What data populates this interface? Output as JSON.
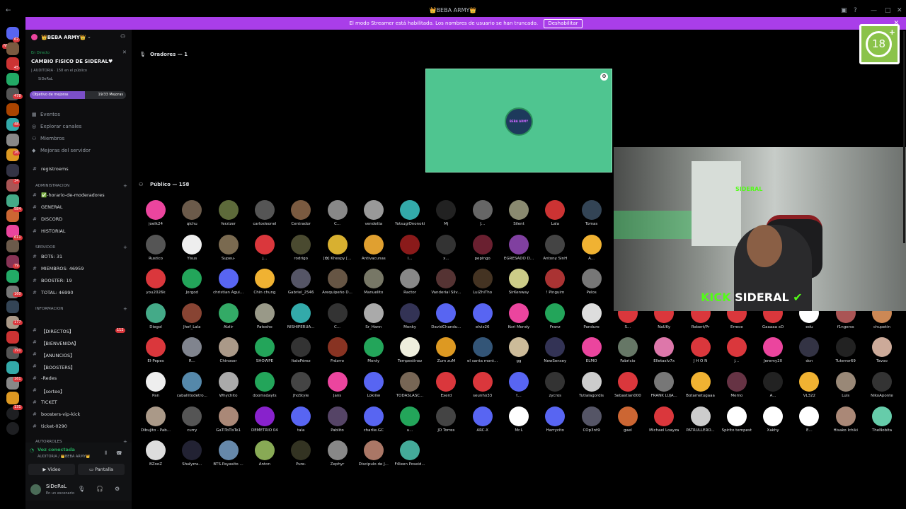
{
  "window": {
    "title": "👑BEBA ARMY👑"
  },
  "banner": {
    "text": "El modo Streamer está habilitado. Los nombres de usuario se han truncado.",
    "button": "Deshabilitar"
  },
  "guild_bar": {
    "new_badge": "NUEVO",
    "badges": [
      "62",
      "45",
      "478",
      "48",
      "26",
      "34",
      "584",
      "611",
      "79",
      "160",
      "177",
      "191",
      "161",
      "131"
    ]
  },
  "server": {
    "name": "👑BEBA ARMY👑",
    "live_tag": "En Directo",
    "stage_title": "CAMBIO FISICO DE SIDERAL♥",
    "stage_meta": "| AUDITORIA · 158 en el público",
    "host": "SiDeRaL",
    "goal_label": "Objetivo de mejoras",
    "goal_progress": "19/33 Mejoras",
    "goal_fraction": 0.576
  },
  "menu": [
    {
      "icon": "calendar-icon",
      "label": "Eventos"
    },
    {
      "icon": "compass-icon",
      "label": "Explorar canales"
    },
    {
      "icon": "members-icon",
      "label": "Miembros"
    },
    {
      "icon": "boost-icon",
      "label": "Mejoras del servidor"
    }
  ],
  "channels": [
    {
      "kind": "channel",
      "label": "registroems"
    },
    {
      "kind": "category",
      "label": "ADMINISTRACION"
    },
    {
      "kind": "channel",
      "label": "✅-horario-de-moderadores"
    },
    {
      "kind": "channel",
      "label": "GENERAL"
    },
    {
      "kind": "channel",
      "label": "DISCORD"
    },
    {
      "kind": "channel",
      "label": "HISTORIAL"
    },
    {
      "kind": "category",
      "label": "SERVIDOR"
    },
    {
      "kind": "channel",
      "label": "BOTS: 31"
    },
    {
      "kind": "channel",
      "label": "MIEMBROS: 46959"
    },
    {
      "kind": "channel",
      "label": "BOOSTER: 19"
    },
    {
      "kind": "channel",
      "label": "TOTAL: 46990"
    },
    {
      "kind": "category",
      "label": "INFORMACION"
    },
    {
      "kind": "channel",
      "label": "【DIRECTOS】",
      "badge": "112"
    },
    {
      "kind": "channel",
      "label": "【BIENVENIDA】"
    },
    {
      "kind": "channel",
      "label": "【ANUNCIOS】"
    },
    {
      "kind": "channel",
      "label": "【BOOSTERS】"
    },
    {
      "kind": "channel",
      "label": "-Redes"
    },
    {
      "kind": "channel",
      "label": "【sorteo】"
    },
    {
      "kind": "channel",
      "label": "TICKET"
    },
    {
      "kind": "channel",
      "label": "boosters-vip-kick"
    },
    {
      "kind": "channel",
      "label": "ticket-0290"
    },
    {
      "kind": "category",
      "label": "AUTORROLES"
    }
  ],
  "voice": {
    "status": "Voz conectada",
    "location": "AUDITORIA / 👑BEBA ARMY👑",
    "video_label": "Video",
    "screen_label": "Pantalla"
  },
  "user": {
    "name": "SiDeRaL",
    "status": "En un escenario"
  },
  "stage": {
    "speakers_header": "Oradores — 1",
    "speaker_avatar_text": "BEBA ARMY",
    "public_header": "Público — 158"
  },
  "audience": [
    {
      "name": "joelk24",
      "color": "#eb459e"
    },
    {
      "name": "qichu",
      "color": "#6b5a4a"
    },
    {
      "name": "ferzizer",
      "color": "#5d6a3a"
    },
    {
      "name": "carlosleonel",
      "color": "#555"
    },
    {
      "name": "Centrador",
      "color": "#7a5a40"
    },
    {
      "name": "C...",
      "color": "#888"
    },
    {
      "name": "vendetta",
      "color": "#999"
    },
    {
      "name": "YotsugiOnonoki",
      "color": "#3aa"
    },
    {
      "name": "Mj",
      "color": "#222"
    },
    {
      "name": "J...",
      "color": "#666"
    },
    {
      "name": "Silent",
      "color": "#8a8a70"
    },
    {
      "name": "Lala",
      "color": "#c33"
    },
    {
      "name": "Tomas",
      "color": "#345"
    },
    {
      "name": "Rustico",
      "color": "#555"
    },
    {
      "name": "Yisus",
      "color": "#eee"
    },
    {
      "name": "Supeu-",
      "color": "#7a6a50"
    },
    {
      "name": "j...",
      "color": "#da373c"
    },
    {
      "name": "rodrigo",
      "color": "#4a4a30"
    },
    {
      "name": "[✿] Khespy [...",
      "color": "#d8b030"
    },
    {
      "name": "Antivacunas",
      "color": "#e0a030"
    },
    {
      "name": "l...",
      "color": "#8a1a1a"
    },
    {
      "name": "x...",
      "color": "#333"
    },
    {
      "name": "pepingo",
      "color": "#6a2030"
    },
    {
      "name": "EGRESADO D...",
      "color": "#8040a0"
    },
    {
      "name": "Antony SinH",
      "color": "#444"
    },
    {
      "name": "A...",
      "color": "#f0b232"
    },
    {
      "name": "you2026k",
      "color": "#da373c"
    },
    {
      "name": "Jorgod",
      "color": "#23a55a"
    },
    {
      "name": "christian Agui...",
      "color": "#5865f2"
    },
    {
      "name": "Chin chung",
      "color": "#f0b232"
    },
    {
      "name": "Gabriel_2546",
      "color": "#556"
    },
    {
      "name": "Arequipeño D...",
      "color": "#654"
    },
    {
      "name": "Manuelito",
      "color": "#776"
    },
    {
      "name": "Ractor",
      "color": "#888"
    },
    {
      "name": "Vanderial Silv...",
      "color": "#533"
    },
    {
      "name": "LuiZhiTho",
      "color": "#432"
    },
    {
      "name": "SirKenway",
      "color": "#cc8"
    },
    {
      "name": "! Pinguim",
      "color": "#a33"
    },
    {
      "name": "Pelos",
      "color": "#777"
    },
    {
      "name": "Diegol",
      "color": "#4a8"
    },
    {
      "name": "Jhef_Lala",
      "color": "#843"
    },
    {
      "name": "Alzlir",
      "color": "#3a6"
    },
    {
      "name": "Patosho",
      "color": "#998"
    },
    {
      "name": "NISHIPERUA...",
      "color": "#3aa"
    },
    {
      "name": "C...",
      "color": "#333"
    },
    {
      "name": "Sr_Hann",
      "color": "#aaa"
    },
    {
      "name": "Monky",
      "color": "#335"
    },
    {
      "name": "DavidChandu...",
      "color": "#5865f2"
    },
    {
      "name": "elviz26",
      "color": "#5865f2"
    },
    {
      "name": "Kori Mondy",
      "color": "#eb459e"
    },
    {
      "name": "Franz",
      "color": "#23a55a"
    },
    {
      "name": "Panduro",
      "color": "#ddd"
    },
    {
      "name": "S...",
      "color": "#da373c"
    },
    {
      "name": "NaUKy",
      "color": "#da373c"
    },
    {
      "name": "Robert/Pr",
      "color": "#da373c"
    },
    {
      "name": "Errece",
      "color": "#da373c"
    },
    {
      "name": "Gaaaaa xD",
      "color": "#da373c"
    },
    {
      "name": "edu",
      "color": "#fff"
    },
    {
      "name": "f1ngerss",
      "color": "#a55"
    },
    {
      "name": "chupetin",
      "color": "#c85"
    },
    {
      "name": "El-Pepes",
      "color": "#da373c"
    },
    {
      "name": "R...",
      "color": "#80848e"
    },
    {
      "name": "Chinosor",
      "color": "#a98"
    },
    {
      "name": "SHOWPE",
      "color": "#23a55a"
    },
    {
      "name": "ItaloPérez",
      "color": "#333"
    },
    {
      "name": "Frdzrro",
      "color": "#832"
    },
    {
      "name": "Monty",
      "color": "#23a55a"
    },
    {
      "name": "Tempestinez",
      "color": "#eed"
    },
    {
      "name": "Zum zuM",
      "color": "#d92"
    },
    {
      "name": "el santa mont...",
      "color": "#357"
    },
    {
      "name": "gg",
      "color": "#cb9"
    },
    {
      "name": "NewSensey",
      "color": "#335"
    },
    {
      "name": "ELMO",
      "color": "#eb459e"
    },
    {
      "name": "Fabricio",
      "color": "#676"
    },
    {
      "name": "ElletasIv7x",
      "color": "#d7a"
    },
    {
      "name": "J H O N",
      "color": "#da373c"
    },
    {
      "name": "j...",
      "color": "#da373c"
    },
    {
      "name": "Jeremy20",
      "color": "#eb459e"
    },
    {
      "name": "dcn",
      "color": "#334"
    },
    {
      "name": "Tuterror69",
      "color": "#222"
    },
    {
      "name": "Tavoo",
      "color": "#ca9"
    },
    {
      "name": "Pan",
      "color": "#eee"
    },
    {
      "name": "caballitodetro...",
      "color": "#58a"
    },
    {
      "name": "Whychito",
      "color": "#aaa"
    },
    {
      "name": "doomsdayts",
      "color": "#23a55a"
    },
    {
      "name": "JhoStyle",
      "color": "#444"
    },
    {
      "name": "Jans",
      "color": "#eb459e"
    },
    {
      "name": "Lokiiiw",
      "color": "#5865f2"
    },
    {
      "name": "TODASLASC...",
      "color": "#765"
    },
    {
      "name": "Exerd",
      "color": "#da373c"
    },
    {
      "name": "seunho33",
      "color": "#da373c"
    },
    {
      "name": "t...",
      "color": "#5865f2"
    },
    {
      "name": "zycros",
      "color": "#333"
    },
    {
      "name": "Tutialagordis",
      "color": "#ccc"
    },
    {
      "name": "Sebastian000",
      "color": "#da373c"
    },
    {
      "name": "FRANK LUJA...",
      "color": "#777"
    },
    {
      "name": "Botametugaaa",
      "color": "#f0b232"
    },
    {
      "name": "Memo",
      "color": "#634"
    },
    {
      "name": "A...",
      "color": "#222"
    },
    {
      "name": "VL322",
      "color": "#f0b232"
    },
    {
      "name": "Luis",
      "color": "#987"
    },
    {
      "name": "NikoAponte",
      "color": "#333"
    },
    {
      "name": "Dibujito - Pab...",
      "color": "#a98"
    },
    {
      "name": "curry",
      "color": "#555"
    },
    {
      "name": "GaTiToTisTe1",
      "color": "#a87"
    },
    {
      "name": "DEMETRIO 04",
      "color": "#82c"
    },
    {
      "name": "tala",
      "color": "#5865f2"
    },
    {
      "name": "Pablito",
      "color": "#546"
    },
    {
      "name": "charlie.GC",
      "color": "#5865f2"
    },
    {
      "name": "u...",
      "color": "#23a55a"
    },
    {
      "name": "JD Torres",
      "color": "#444"
    },
    {
      "name": "ARC-X",
      "color": "#5865f2"
    },
    {
      "name": "Mr.L",
      "color": "#fff"
    },
    {
      "name": "Harrycito",
      "color": "#5865f2"
    },
    {
      "name": "COp3nt9",
      "color": "#556"
    },
    {
      "name": "gael",
      "color": "#c63"
    },
    {
      "name": "Michael Loayza",
      "color": "#da373c"
    },
    {
      "name": "PATRULLERO...",
      "color": "#ccc"
    },
    {
      "name": "Spirito tempest",
      "color": "#fff"
    },
    {
      "name": "Xakhy",
      "color": "#fff"
    },
    {
      "name": "E...",
      "color": "#fff"
    },
    {
      "name": "Hisako Ichiki",
      "color": "#a87"
    },
    {
      "name": "TheNobita",
      "color": "#6ca"
    },
    {
      "name": "BZooZ",
      "color": "#ddd"
    },
    {
      "name": "Sh𝖔ℓy𝖗n𝖊...",
      "color": "#223"
    },
    {
      "name": "BTS.Payasito ...",
      "color": "#68a"
    },
    {
      "name": "Anton",
      "color": "#8a5"
    },
    {
      "name": "Pure-",
      "color": "#332"
    },
    {
      "name": "Zephyr",
      "color": "#888"
    },
    {
      "name": "Discipulo de J...",
      "color": "#a76"
    },
    {
      "name": "F4leen Poseid...",
      "color": "#4a9"
    }
  ],
  "webcam": {
    "kick_word": "KICK",
    "streamer_word": "SIDERAL",
    "wall_logo": "SIDERAL"
  },
  "age_badge": {
    "number": "18",
    "plus": "+"
  }
}
